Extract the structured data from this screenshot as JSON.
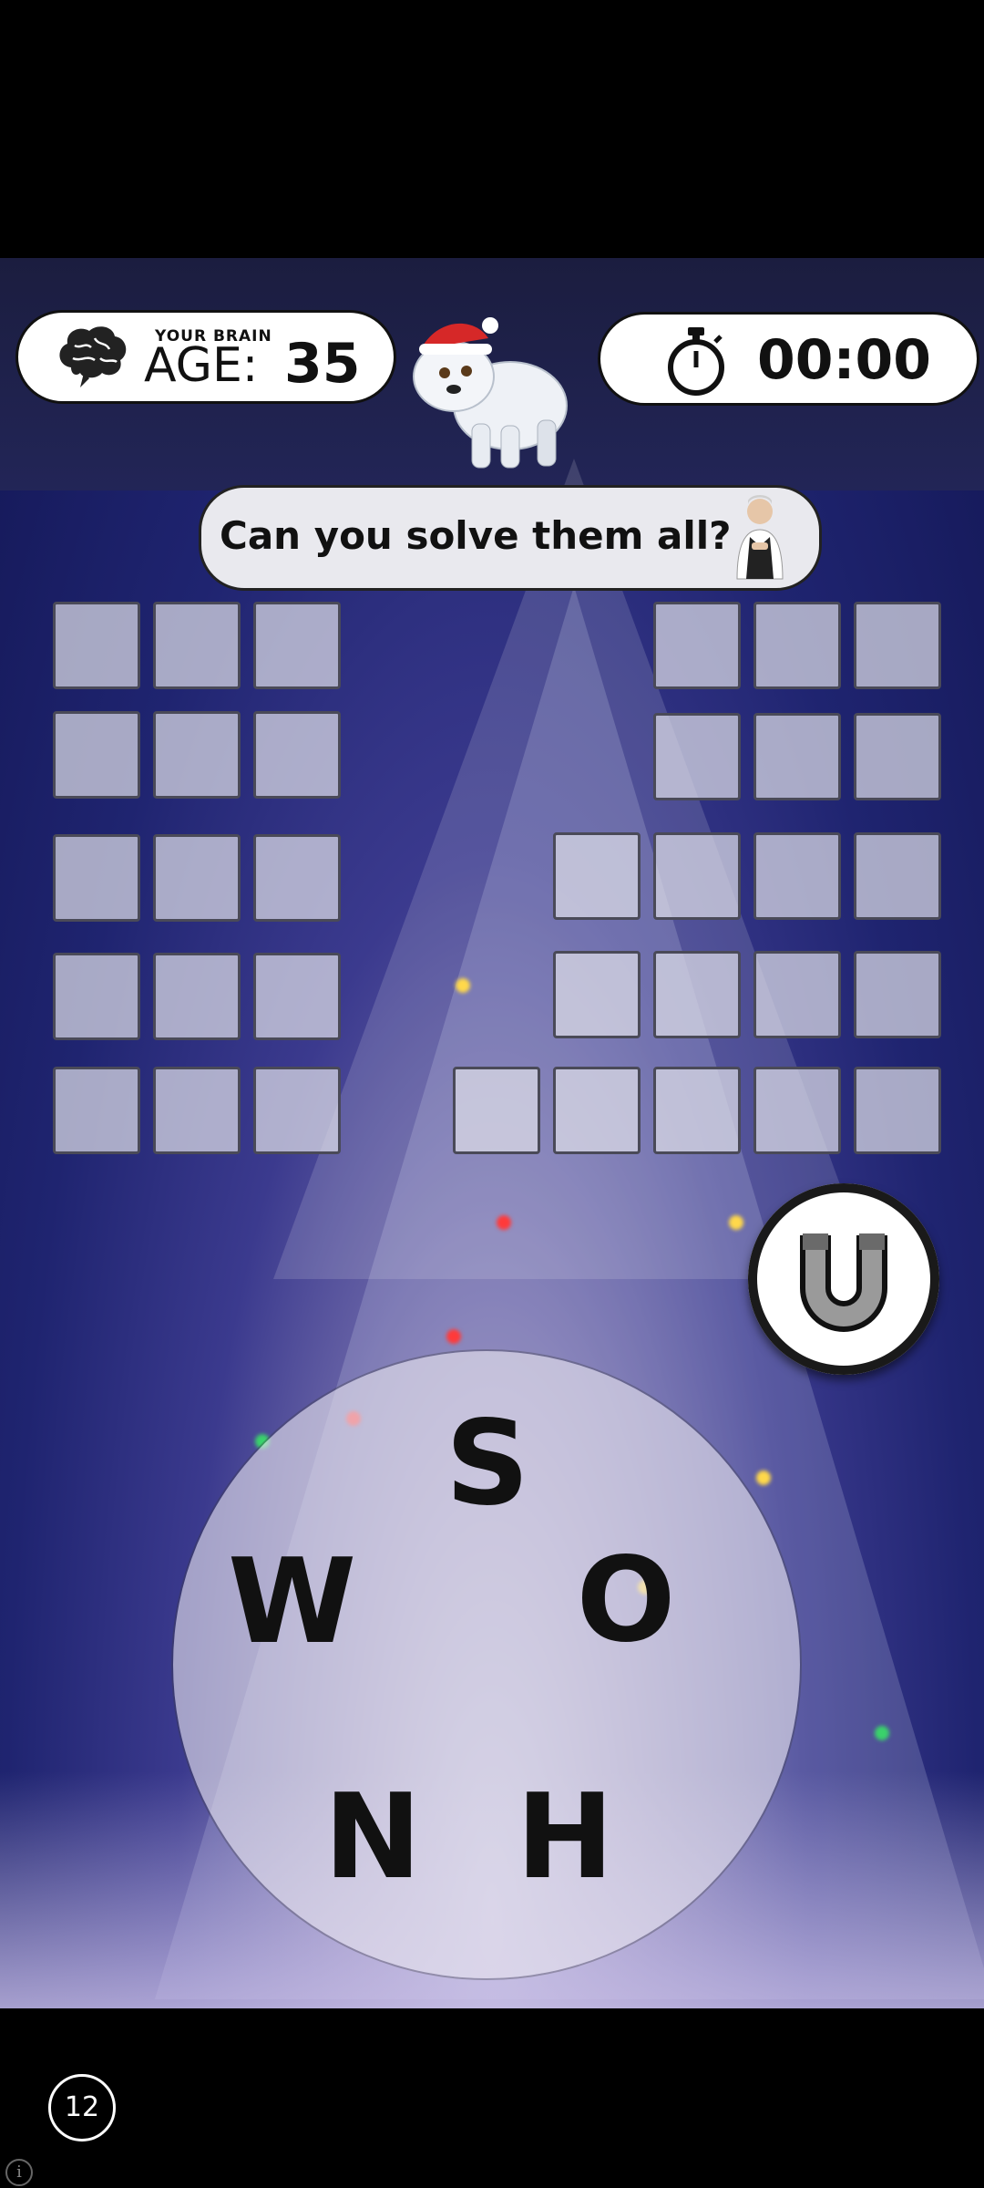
{
  "header": {
    "brain_label": "YOUR BRAIN",
    "age_label": "AGE:",
    "age_value": "35",
    "timer": "00:00"
  },
  "speech": {
    "text": "Can you solve them all?"
  },
  "board": {
    "left_rows": [
      3,
      3,
      3,
      3,
      3
    ],
    "right_rows": [
      3,
      3,
      4,
      4,
      5
    ]
  },
  "wheel": {
    "letters": [
      "S",
      "O",
      "H",
      "N",
      "W"
    ]
  },
  "footer": {
    "level_badge": "12",
    "info_icon": "i"
  },
  "icons": [
    "brain-icon",
    "stopwatch-icon",
    "magnet-icon",
    "polar-bear-mascot",
    "character-avatar",
    "info-icon"
  ]
}
